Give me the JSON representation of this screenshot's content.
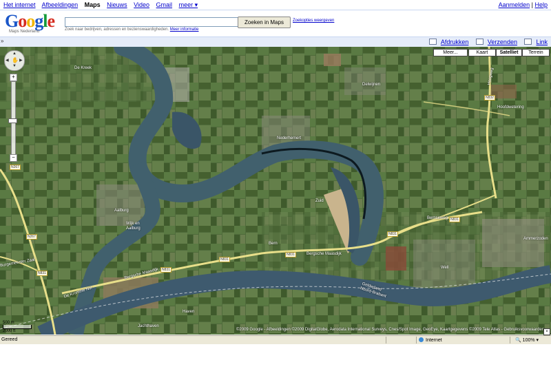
{
  "topbar": {
    "links": [
      "Het internet",
      "Afbeeldingen",
      "Maps",
      "Nieuws",
      "Video",
      "Gmail",
      "meer ▾"
    ],
    "signin": "Aanmelden",
    "separator": "|",
    "help": "Help"
  },
  "logo": {
    "word": "Google",
    "subtitle": "Maps Nederland"
  },
  "search": {
    "value": "",
    "button": "Zoeken in Maps",
    "options": "Zoekopties weergeven",
    "hint": "Zoek naar bedrijven, adressen en bezienswaardigheden.",
    "hint_link": "Meer informatie"
  },
  "toolsbar": {
    "collapse": "»",
    "print": "Afdrukken",
    "send": "Verzenden",
    "link": "Link"
  },
  "maptypes": {
    "more": "Meer...",
    "map": "Kaart",
    "satellite": "Satelliet",
    "terrain": "Terrein"
  },
  "places": {
    "de_kreek": "De Kreek",
    "delwijnen": "Delwijnen",
    "nederhemert": "Nederhemert",
    "zuid": "Zuid",
    "aalburg": "Aalburg",
    "wijk_en_aalburg_1": "Wijk en",
    "wijk_en_aalburg_2": "Aalburg",
    "bern": "Bern",
    "well": "Well",
    "ammerzoden": "Ammerzoden",
    "haven": "Haven",
    "jachthaven": "Jachthaven",
    "hoofdwetering": "Hoofdwetering",
    "gelderland": "Gelderland",
    "noord_brabant": "Noord-Brabant",
    "bergsche_maasdijk_1": "Bergsche Maasdijk",
    "bergsche_maasdijk_2": "Bergsche Maasdijk",
    "de_kromme_nol": "De Kromme Nol",
    "bernseweg": "Bernseweg",
    "hoogweg": "Hoogweg",
    "burgemeester_zaal": "Burgemeester Zaal"
  },
  "roads": {
    "n267_a": "N267",
    "n267_b": "N267",
    "n831_a": "N831",
    "n831_b": "N831",
    "n831_c": "N831",
    "n831_d": "N831",
    "n831_e": "N831",
    "n831_f": "N831",
    "n832": "N832"
  },
  "map": {
    "scale_m": "500 m",
    "scale_ft": "2000 ft",
    "copyright": "©2009 Google - Afbeeldingen ©2009 DigitalGlobe, Aerodata International Surveys, Cnes/Spot Image, GeoEye, Kaartgegevens ©2009 Tele Atlas - Gebruiksvoorwaarden",
    "colors": {
      "river": "#3e5a6e",
      "fields": "#4d6a3a",
      "road": "#e8df8a"
    }
  },
  "statusbar": {
    "status": "Gereed",
    "zone": "Internet",
    "zoom": "100%"
  }
}
